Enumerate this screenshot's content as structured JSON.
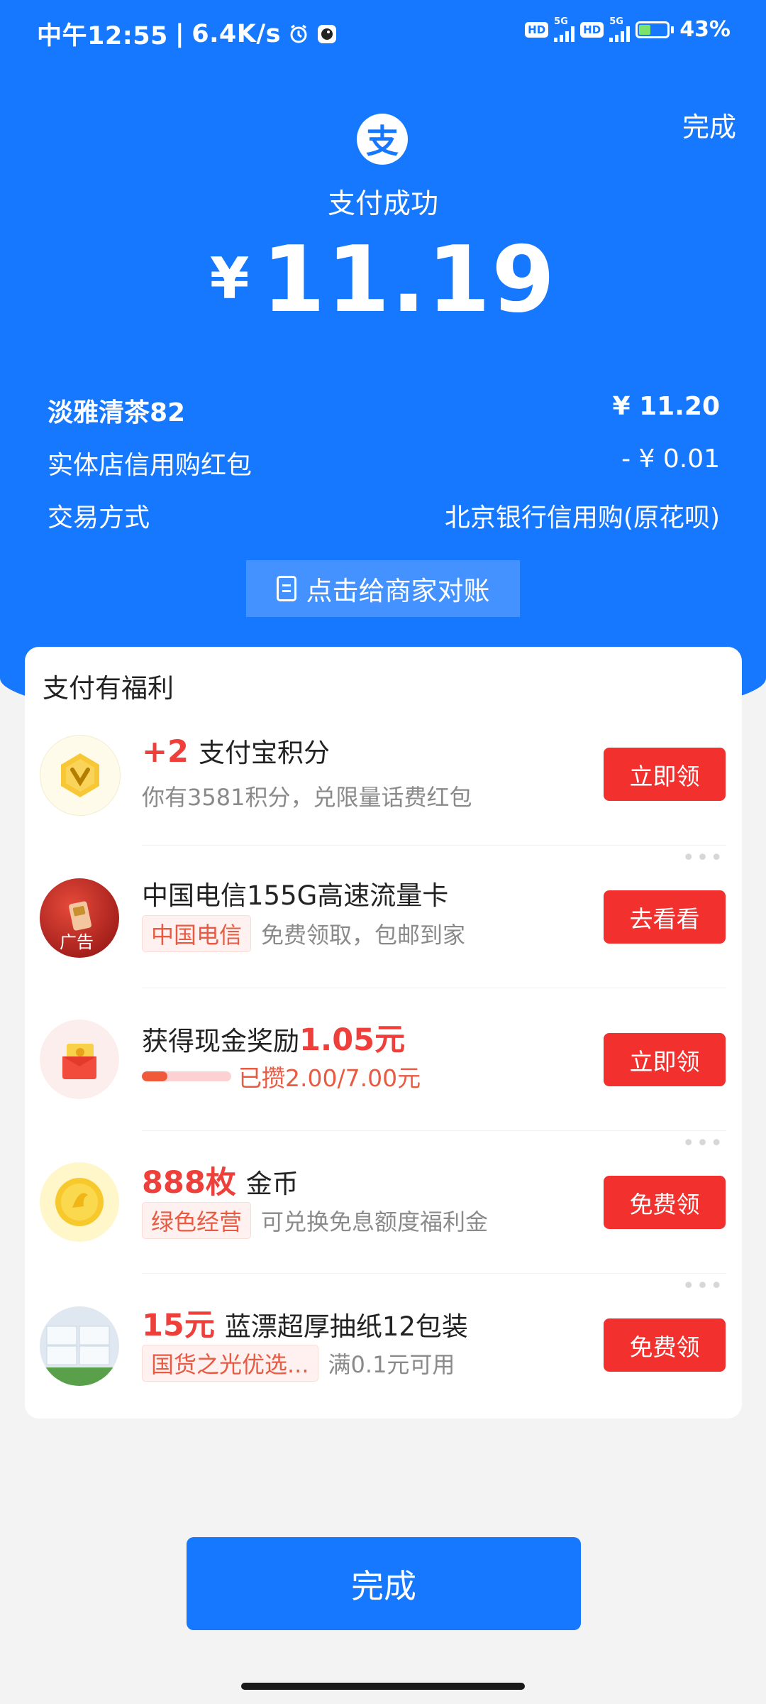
{
  "status_bar": {
    "time": "中午12:55",
    "network_speed": "6.4K/s",
    "hd_badge": "HD",
    "net_type": "5G",
    "battery": "43%",
    "battery_level": 0.43
  },
  "header": {
    "done_label": "完成",
    "logo_glyph": "支",
    "status_text": "支付成功",
    "currency": "¥",
    "amount": "11.19"
  },
  "details": [
    {
      "label": "淡雅清茶82",
      "value": "¥ 11.20"
    },
    {
      "label": "实体店信用购红包",
      "value": "- ¥ 0.01"
    },
    {
      "label": "交易方式",
      "value": "北京银行信用购(原花呗)"
    }
  ],
  "reconcile_button": "点击给商家对账",
  "benefits": {
    "title": "支付有福利",
    "items": [
      {
        "highlight": "+2",
        "title": "支付宝积分",
        "subtitle": "你有3581积分，兑限量话费红包",
        "button": "立即领",
        "icon": "points-coin-icon"
      },
      {
        "title": "中国电信155G高速流量卡",
        "tag": "中国电信",
        "subtitle": "免费领取，包邮到家",
        "ad_label": "广告",
        "button": "去看看",
        "icon": "sim-card-ad-icon"
      },
      {
        "title": "获得现金奖励",
        "highlight": "1.05元",
        "progress_text": "已攒2.00/7.00元",
        "progress_value": 0.2857,
        "button": "立即领",
        "icon": "red-envelope-icon"
      },
      {
        "highlight": "888枚",
        "title": "金币",
        "tag": "绿色经营",
        "subtitle": "可兑换免息额度福利金",
        "button": "免费领",
        "icon": "gold-coin-icon"
      },
      {
        "highlight": "15元",
        "title": "蓝漂超厚抽纸12包装",
        "tag": "国货之光优选...",
        "subtitle": "满0.1元可用",
        "button": "免费领",
        "icon": "tissue-pack-icon"
      }
    ]
  },
  "bottom_button": "完成",
  "colors": {
    "brand_blue": "#1677ff",
    "action_red": "#f2312e",
    "highlight_red": "#ee3f3a"
  }
}
